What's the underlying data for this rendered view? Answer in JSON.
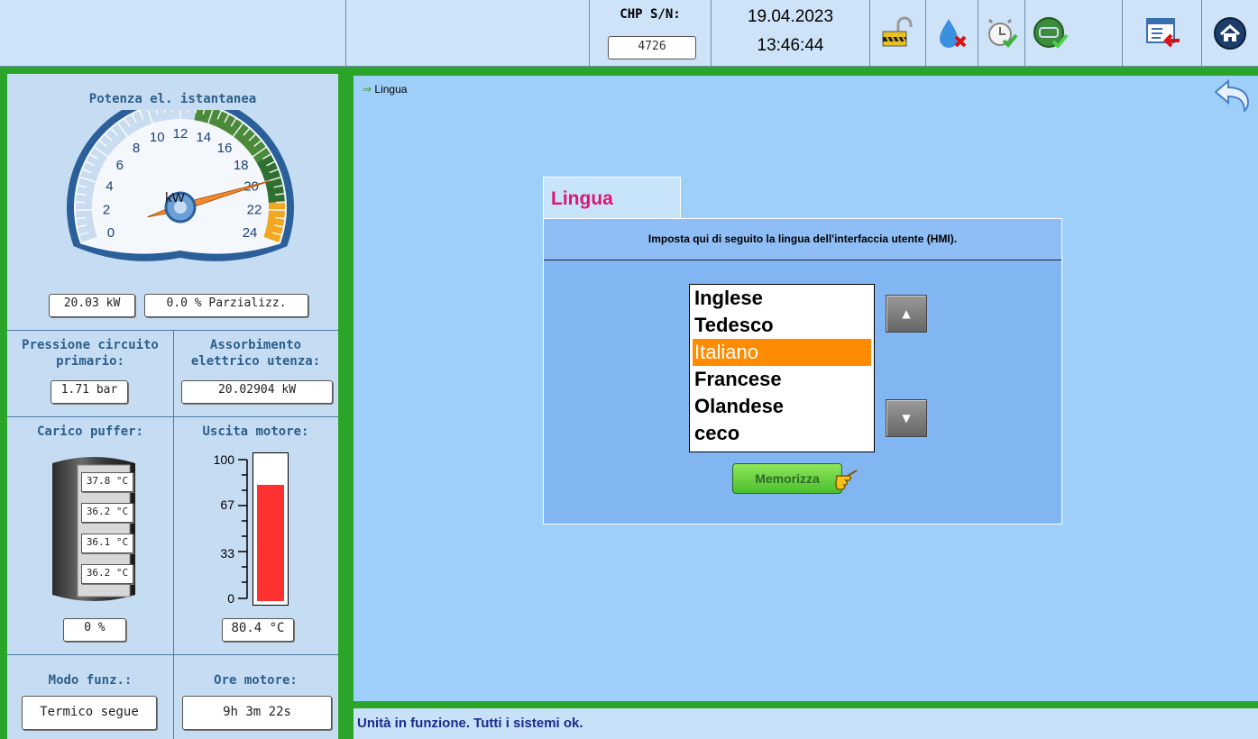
{
  "header": {
    "sn_label": "CHP S/N:",
    "sn_value": "4726",
    "date": "19.04.2023",
    "time": "13:46:44",
    "icons": [
      "unlock-icon",
      "water-error-icon",
      "timer-ok-icon",
      "engine-ok-icon",
      "exit-icon",
      "home-icon"
    ]
  },
  "gauge": {
    "title": "Potenza el. istantanea",
    "unit": "kW",
    "ticks": [
      "0",
      "2",
      "4",
      "6",
      "8",
      "10",
      "12",
      "14",
      "16",
      "18",
      "20",
      "22",
      "24"
    ],
    "value": 20.03,
    "min": 0,
    "max": 24,
    "power_box": "20.03 kW",
    "partial_box": "0.0 % Parzializz."
  },
  "pressure": {
    "label_1": "Pressione circuito",
    "label_2": "primario:",
    "value": "1.71 bar"
  },
  "absorption": {
    "label_1": "Assorbimento",
    "label_2": "elettrico utenza:",
    "value": "20.02904 kW"
  },
  "buffer": {
    "label": "Carico puffer:",
    "temps": [
      "37.8 °C",
      "36.2 °C",
      "36.1 °C",
      "36.2 °C"
    ],
    "value": "0 %"
  },
  "engine_out": {
    "label": "Uscita motore:",
    "ticks": [
      "100",
      "67",
      "33",
      "0"
    ],
    "level_percent": 80.4,
    "value": "80.4 °C"
  },
  "mode": {
    "label": "Modo funz.:",
    "value": "Termico segue"
  },
  "hours": {
    "label": "Ore motore:",
    "value": "9h 3m 22s"
  },
  "breadcrumb": "Lingua",
  "dialog": {
    "tab_title": "Lingua",
    "description": "Imposta qui di seguito la lingua dell'interfaccia utente (HMI).",
    "languages": [
      "Inglese",
      "Tedesco",
      "Italiano",
      "Francese",
      "Olandese",
      "ceco"
    ],
    "selected": "Italiano",
    "save_label": "Memorizza"
  },
  "status": "Unità in funzione. Tutti i sistemi ok.",
  "colors": {
    "frame_green": "#2aa52a",
    "selected_orange": "#ff8c00",
    "tab_title_pink": "#e0146e",
    "status_text": "#1a2c8c"
  }
}
